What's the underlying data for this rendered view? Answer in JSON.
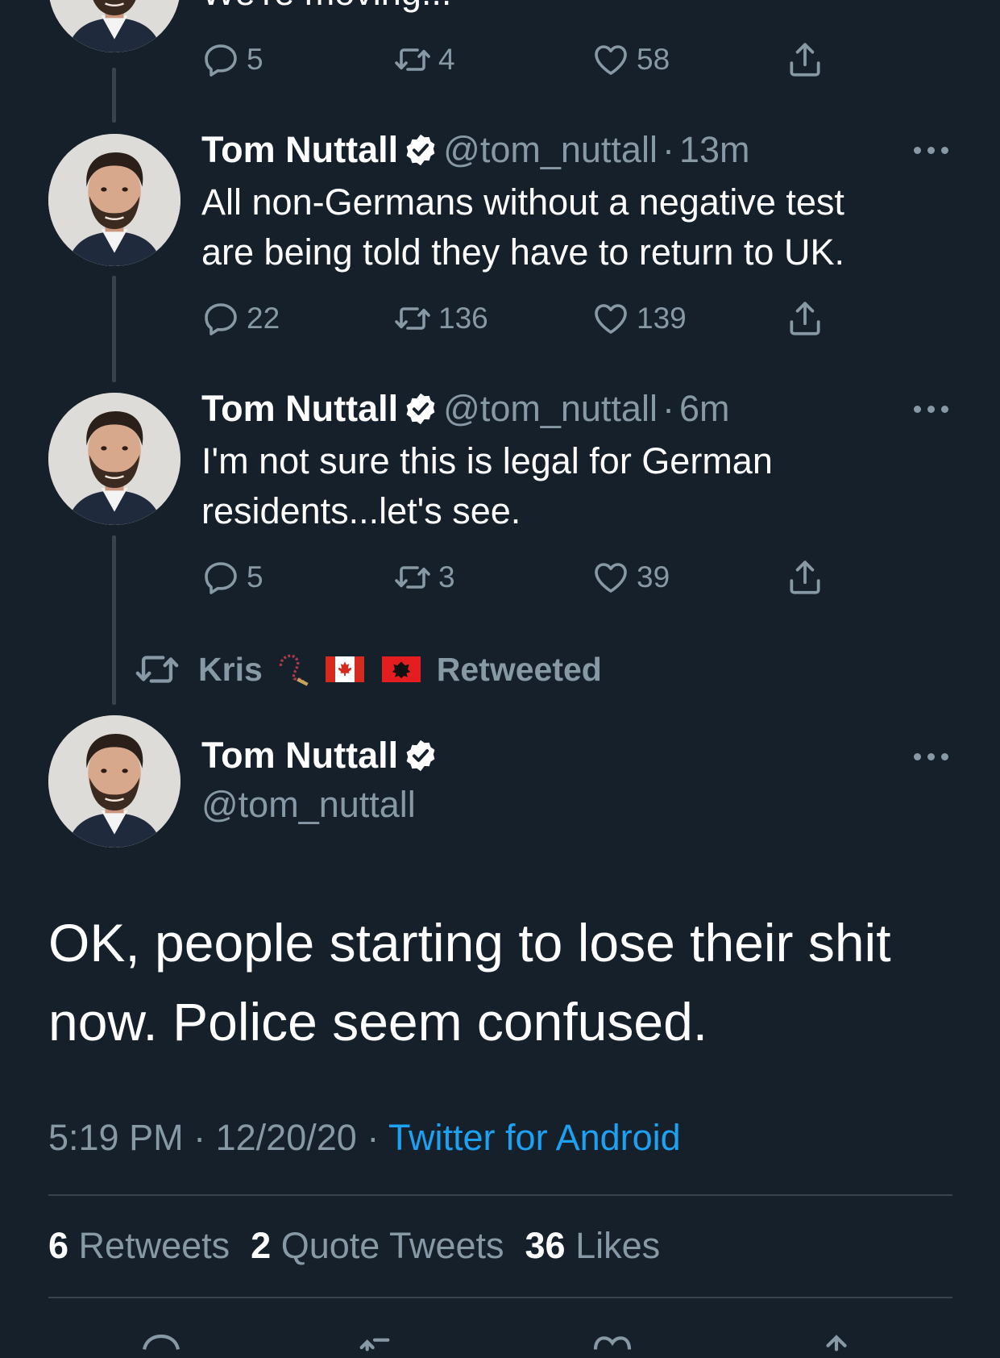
{
  "colors": {
    "background": "#15202b",
    "text": "#ffffff",
    "muted": "#8899a6",
    "accent": "#1da1f2",
    "divider": "#38444d"
  },
  "top_partial_tweet": {
    "text_fragment": "We're moving...",
    "replies": "5",
    "retweets": "4",
    "likes": "58"
  },
  "tweet1": {
    "name": "Tom Nuttall",
    "handle": "@tom_nuttall",
    "sep": "·",
    "time": "13m",
    "line1": "All non-Germans without a negative test",
    "line2": "are being told they have to return to UK.",
    "replies": "22",
    "retweets": "136",
    "likes": "139"
  },
  "tweet2": {
    "name": "Tom Nuttall",
    "handle": "@tom_nuttall",
    "sep": "·",
    "time": "6m",
    "line1": "I'm not sure this is legal for German",
    "line2": "residents...let's see.",
    "replies": "5",
    "retweets": "3",
    "likes": "39"
  },
  "retweet_banner": {
    "user": "Kris",
    "label": "Retweeted",
    "emojis": [
      "rosary-emoji",
      "canada-flag",
      "albania-flag"
    ]
  },
  "main_tweet": {
    "name": "Tom Nuttall",
    "handle": "@tom_nuttall",
    "line1": "OK, people starting to lose their shit",
    "line2": "now. Police seem confused.",
    "time": "5:19 PM",
    "sep": "·",
    "date": "12/20/20",
    "source": "Twitter for Android",
    "retweets_count": "6",
    "retweets_label": "Retweets",
    "quotes_count": "2",
    "quotes_label": "Quote Tweets",
    "likes_count": "36",
    "likes_label": "Likes"
  },
  "icons": [
    "reply-icon",
    "retweet-icon",
    "like-icon",
    "share-icon",
    "verified-badge-icon",
    "more-icon"
  ]
}
